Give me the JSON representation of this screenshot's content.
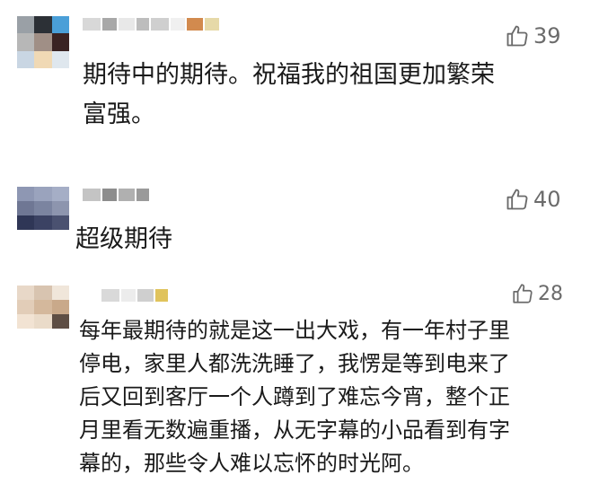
{
  "comments": [
    {
      "likes": "39",
      "text": "期待中的期待。祝福我的祖国更加繁荣\n富强。",
      "avatar_colors": [
        "#9aa0a6",
        "#2c3036",
        "#4a9fd8",
        "#b7b7b7",
        "#a08f86",
        "#3a2323",
        "#c9d6e3",
        "#f0d9b5",
        "#dfe7ee"
      ],
      "name_colors": [
        "#d8d8d8",
        "#a8a8a8",
        "#e8e8e8",
        "#bdbdbd",
        "#cfcfcf",
        "#f0f0f0",
        "#d28a4e",
        "#e6d9a8"
      ]
    },
    {
      "likes": "40",
      "text": "超级期待",
      "avatar_colors": [
        "#8e97b3",
        "#9aa3bd",
        "#a5aec6",
        "#6f7794",
        "#7b84a0",
        "#8d95ae",
        "#2f3656",
        "#3b4263",
        "#4a5170"
      ],
      "name_colors": [
        "#c4c4c4",
        "#8d8d8d",
        "#b0b0b0",
        "#9a9a9a"
      ]
    },
    {
      "likes": "28",
      "text": "每年最期待的就是这一出大戏，有一年村子里\n停电，家里人都洗洗睡了，我愣是等到电来了\n后又回到客厅一个人蹲到了难忘今宵，整个正\n月里看无数遍重播，从无字幕的小品看到有字\n幕的，那些令人难以忘怀的时光阿。",
      "avatar_colors": [
        "#e8d8c8",
        "#d8c4b0",
        "#f0e6da",
        "#e2cdb8",
        "#d4b89c",
        "#c9a98a",
        "#f2e3d3",
        "#eadbc9",
        "#5e4e44"
      ],
      "name_colors": [
        "#d9d9d9",
        "#ececec",
        "#cfcfcf",
        "#e0c35c"
      ]
    }
  ]
}
